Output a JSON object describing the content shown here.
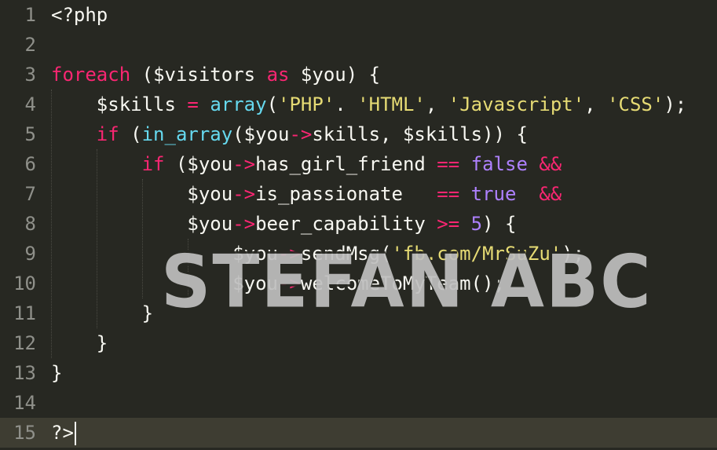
{
  "theme": {
    "background": "#272822",
    "active_line": "#3e3d32",
    "plain": "#f8f8f2",
    "keyword": "#f92672",
    "storage": "#66d9ef",
    "string": "#e6db74",
    "constant": "#ae81ff",
    "gutter": "#8f908a"
  },
  "line_numbers": [
    "1",
    "2",
    "3",
    "4",
    "5",
    "6",
    "7",
    "8",
    "9",
    "10",
    "11",
    "12",
    "13",
    "14",
    "15"
  ],
  "active_line": 15,
  "lines": [
    [
      {
        "t": "<?php",
        "c": "p"
      }
    ],
    [],
    [
      {
        "t": "foreach",
        "c": "k"
      },
      {
        "t": " (",
        "c": "p"
      },
      {
        "t": "$visitors",
        "c": "p"
      },
      {
        "t": " ",
        "c": "p"
      },
      {
        "t": "as",
        "c": "k"
      },
      {
        "t": " ",
        "c": "p"
      },
      {
        "t": "$you",
        "c": "p"
      },
      {
        "t": ") {",
        "c": "p"
      }
    ],
    [
      {
        "t": "    ",
        "c": "p"
      },
      {
        "t": "$skills",
        "c": "p"
      },
      {
        "t": " ",
        "c": "p"
      },
      {
        "t": "=",
        "c": "k"
      },
      {
        "t": " ",
        "c": "p"
      },
      {
        "t": "array",
        "c": "s"
      },
      {
        "t": "(",
        "c": "p"
      },
      {
        "t": "'PHP'",
        "c": "q"
      },
      {
        "t": ". ",
        "c": "p"
      },
      {
        "t": "'HTML'",
        "c": "q"
      },
      {
        "t": ", ",
        "c": "p"
      },
      {
        "t": "'Javascript'",
        "c": "q"
      },
      {
        "t": ", ",
        "c": "p"
      },
      {
        "t": "'CSS'",
        "c": "q"
      },
      {
        "t": ");",
        "c": "p"
      }
    ],
    [
      {
        "t": "    ",
        "c": "p"
      },
      {
        "t": "if",
        "c": "k"
      },
      {
        "t": " (",
        "c": "p"
      },
      {
        "t": "in_array",
        "c": "s"
      },
      {
        "t": "(",
        "c": "p"
      },
      {
        "t": "$you",
        "c": "p"
      },
      {
        "t": "->",
        "c": "k"
      },
      {
        "t": "skills, ",
        "c": "p"
      },
      {
        "t": "$skills",
        "c": "p"
      },
      {
        "t": ")) {",
        "c": "p"
      }
    ],
    [
      {
        "t": "        ",
        "c": "p"
      },
      {
        "t": "if",
        "c": "k"
      },
      {
        "t": " (",
        "c": "p"
      },
      {
        "t": "$you",
        "c": "p"
      },
      {
        "t": "->",
        "c": "k"
      },
      {
        "t": "has_girl_friend ",
        "c": "p"
      },
      {
        "t": "==",
        "c": "k"
      },
      {
        "t": " ",
        "c": "p"
      },
      {
        "t": "false",
        "c": "n"
      },
      {
        "t": " ",
        "c": "p"
      },
      {
        "t": "&&",
        "c": "k"
      }
    ],
    [
      {
        "t": "            ",
        "c": "p"
      },
      {
        "t": "$you",
        "c": "p"
      },
      {
        "t": "->",
        "c": "k"
      },
      {
        "t": "is_passionate   ",
        "c": "p"
      },
      {
        "t": "==",
        "c": "k"
      },
      {
        "t": " ",
        "c": "p"
      },
      {
        "t": "true",
        "c": "n"
      },
      {
        "t": "  ",
        "c": "p"
      },
      {
        "t": "&&",
        "c": "k"
      }
    ],
    [
      {
        "t": "            ",
        "c": "p"
      },
      {
        "t": "$you",
        "c": "p"
      },
      {
        "t": "->",
        "c": "k"
      },
      {
        "t": "beer_capability ",
        "c": "p"
      },
      {
        "t": ">=",
        "c": "k"
      },
      {
        "t": " ",
        "c": "p"
      },
      {
        "t": "5",
        "c": "n"
      },
      {
        "t": ") {",
        "c": "p"
      }
    ],
    [
      {
        "t": "                ",
        "c": "p"
      },
      {
        "t": "$you",
        "c": "p"
      },
      {
        "t": "->",
        "c": "k"
      },
      {
        "t": "sendMsg(",
        "c": "p"
      },
      {
        "t": "'fb.com/MrSuZu'",
        "c": "q"
      },
      {
        "t": ");",
        "c": "p"
      }
    ],
    [
      {
        "t": "                ",
        "c": "p"
      },
      {
        "t": "$you",
        "c": "p"
      },
      {
        "t": "->",
        "c": "k"
      },
      {
        "t": "welcomeToMyTeam();",
        "c": "p"
      }
    ],
    [
      {
        "t": "        }",
        "c": "p"
      }
    ],
    [
      {
        "t": "    }",
        "c": "p"
      }
    ],
    [
      {
        "t": "}",
        "c": "p"
      }
    ],
    [],
    [
      {
        "t": "?>",
        "c": "p"
      }
    ]
  ],
  "watermark": "STEFAN ABC"
}
